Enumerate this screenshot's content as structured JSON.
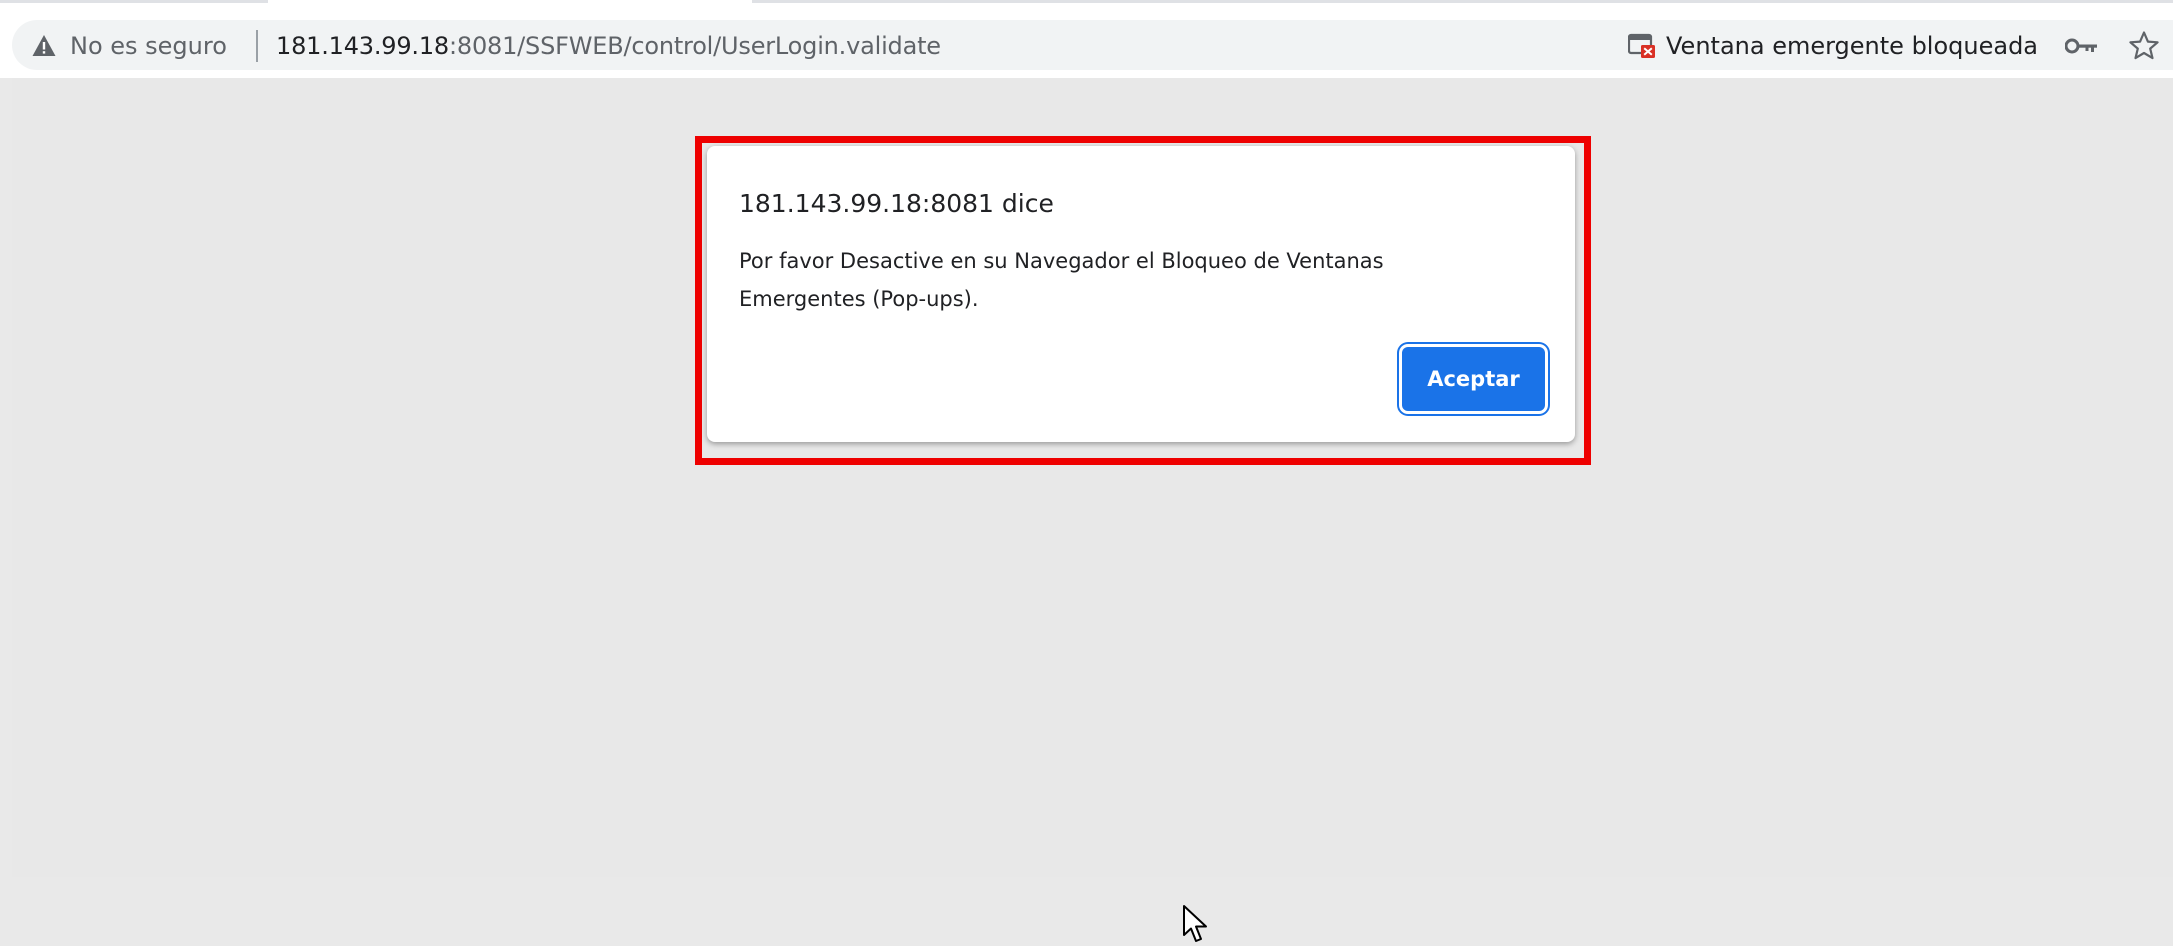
{
  "address_bar": {
    "security_label": "No es seguro",
    "url_host": "181.143.99.18",
    "url_rest": ":8081/SSFWEB/control/UserLogin.validate",
    "popup_blocked_label": "Ventana emergente bloqueada",
    "icons": [
      "warning-triangle-icon",
      "popup-blocked-icon",
      "key-icon",
      "star-icon"
    ]
  },
  "dialog": {
    "origin": "181.143.99.18:8081 dice",
    "message": "Por favor Desactive en su Navegador el Bloqueo de Ventanas Emergentes (Pop-ups).",
    "ok_label": "Aceptar"
  },
  "colors": {
    "highlight": "#ee0000",
    "accent": "#1a73e8",
    "page_background": "#e8e8e8"
  }
}
